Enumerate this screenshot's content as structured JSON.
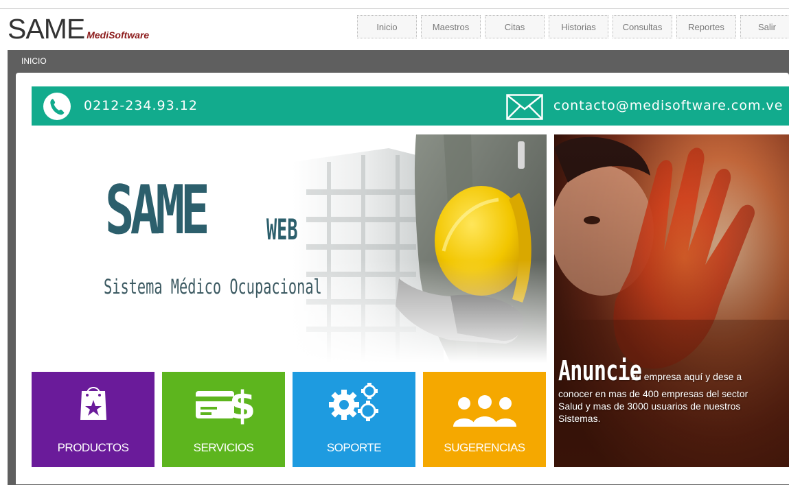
{
  "header": {
    "brand_main": "SAME",
    "brand_sub": "MediSoftware",
    "nav": [
      {
        "label": "Inicio"
      },
      {
        "label": "Maestros"
      },
      {
        "label": "Citas"
      },
      {
        "label": "Historias"
      },
      {
        "label": "Consultas"
      },
      {
        "label": "Reportes"
      },
      {
        "label": "Salir"
      }
    ]
  },
  "panel": {
    "title": "INICIO"
  },
  "contact": {
    "phone": "0212-234.93.12",
    "email": "contacto@medisoftware.com.ve",
    "phone_icon": "phone-icon",
    "mail_icon": "envelope-icon"
  },
  "hero": {
    "title_main": "SAME",
    "title_suffix": "WEB",
    "subtitle": "Sistema Médico Ocupacional"
  },
  "tiles": [
    {
      "label": "PRODUCTOS",
      "icon": "shopping-bag-icon",
      "color": "#6a1b9a"
    },
    {
      "label": "SERVICIOS",
      "icon": "credit-card-dollar-icon",
      "color": "#5db51e"
    },
    {
      "label": "SOPORTE",
      "icon": "gears-icon",
      "color": "#1e9be0"
    },
    {
      "label": "SUGERENCIAS",
      "icon": "users-group-icon",
      "color": "#f5a800"
    }
  ],
  "ad": {
    "headline": "Anuncie",
    "line1": "su empresa aquí y dese a",
    "line2": "conocer en mas de 400 empresas del sector",
    "line3": "Salud y mas de 3000  usuarios de nuestros",
    "line4": "Sistemas."
  },
  "colors": {
    "contact_bar": "#12ab8d",
    "panel": "#5f5f5f",
    "hero_text": "#2c5f6c"
  }
}
